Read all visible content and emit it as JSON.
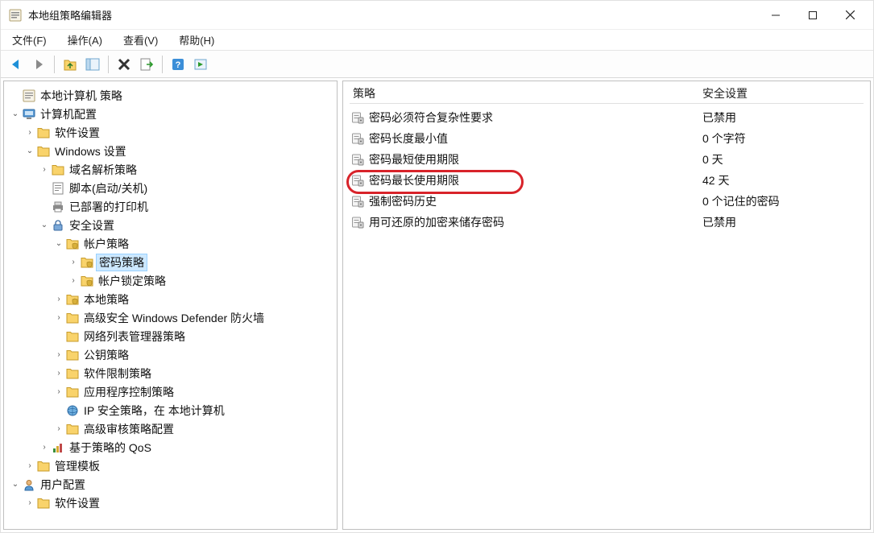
{
  "window": {
    "title": "本地组策略编辑器"
  },
  "menu": {
    "file": "文件(F)",
    "action": "操作(A)",
    "view": "查看(V)",
    "help": "帮助(H)"
  },
  "toolbarIcons": [
    "back",
    "forward",
    "up",
    "refresh",
    "delete",
    "export",
    "help",
    "play"
  ],
  "tree": {
    "root": "本地计算机 策略",
    "computerConfig": "计算机配置",
    "softwareSettings": "软件设置",
    "windowsSettings": "Windows 设置",
    "nameResolution": "域名解析策略",
    "scripts": "脚本(启动/关机)",
    "deployedPrinters": "已部署的打印机",
    "securitySettings": "安全设置",
    "accountPolicies": "帐户策略",
    "passwordPolicy": "密码策略",
    "accountLockout": "帐户锁定策略",
    "localPolicies": "本地策略",
    "defenderFirewall": "高级安全 Windows Defender 防火墙",
    "networkListManager": "网络列表管理器策略",
    "publicKeyPolicies": "公钥策略",
    "softwareRestriction": "软件限制策略",
    "appControl": "应用程序控制策略",
    "ipSecurity": "IP 安全策略，在 本地计算机",
    "advancedAudit": "高级审核策略配置",
    "policyQoS": "基于策略的 QoS",
    "adminTemplates": "管理模板",
    "userConfig": "用户配置",
    "userSoftwareSettings": "软件设置"
  },
  "list": {
    "headerPolicy": "策略",
    "headerSetting": "安全设置",
    "rows": [
      {
        "policy": "密码必须符合复杂性要求",
        "value": "已禁用",
        "highlighted": false
      },
      {
        "policy": "密码长度最小值",
        "value": "0 个字符",
        "highlighted": false
      },
      {
        "policy": "密码最短使用期限",
        "value": "0 天",
        "highlighted": false
      },
      {
        "policy": "密码最长使用期限",
        "value": "42 天",
        "highlighted": true
      },
      {
        "policy": "强制密码历史",
        "value": "0 个记住的密码",
        "highlighted": false
      },
      {
        "policy": "用可还原的加密来储存密码",
        "value": "已禁用",
        "highlighted": false
      }
    ]
  }
}
